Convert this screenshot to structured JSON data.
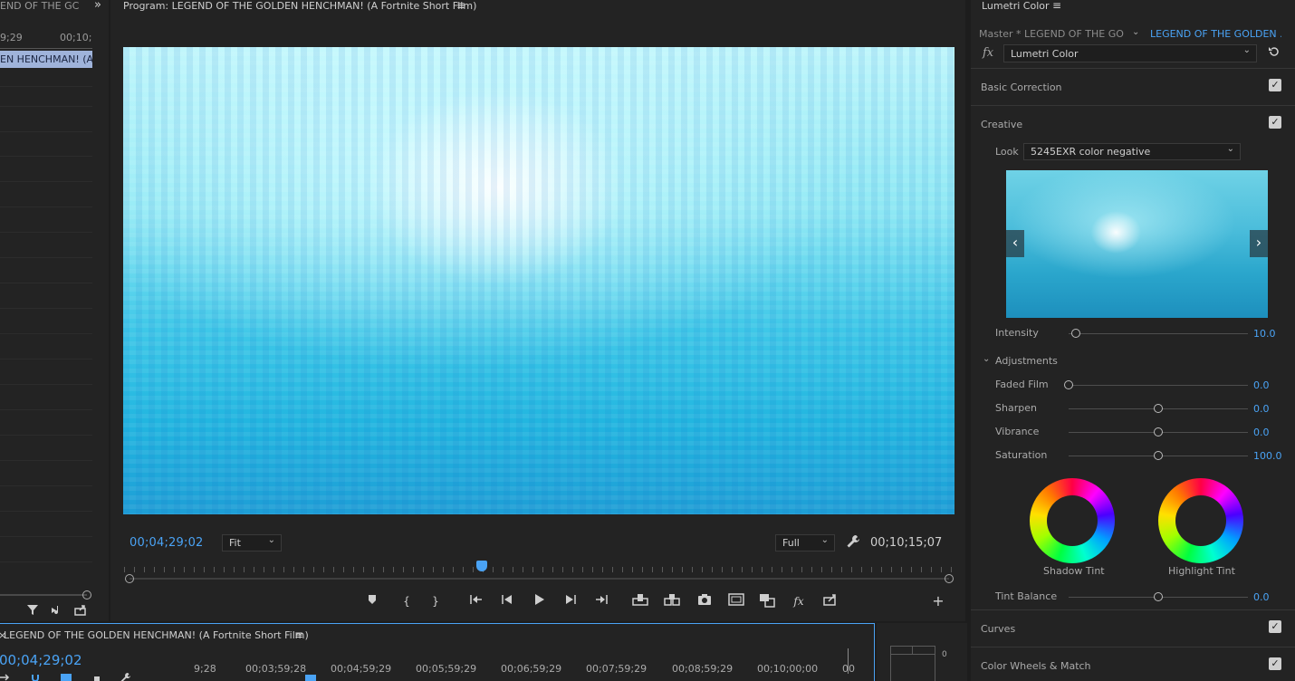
{
  "left_panel": {
    "tab_title": "END OF THE GC",
    "more_icon": "»",
    "ruler": [
      "9;29",
      "00;10;("
    ],
    "clip_label": "EN HENCHMAN! (A"
  },
  "program_monitor": {
    "title": "Program: LEGEND OF THE GOLDEN HENCHMAN! (A Fortnite Short Film)",
    "menu_icon": "≡",
    "current_timecode": "00;04;29;02",
    "zoom_select": "Fit",
    "resolution_select": "Full",
    "duration_timecode": "00;10;15;07",
    "playhead_fraction": 0.43,
    "transport": {
      "marker": "marker-icon",
      "in_point": "mark-in-icon",
      "out_point": "mark-out-icon",
      "go_to_in": "go-to-in-icon",
      "step_back": "step-back-icon",
      "play": "play-icon",
      "step_forward": "step-forward-icon",
      "go_to_out": "go-to-out-icon",
      "lift": "lift-icon",
      "extract": "extract-icon",
      "export_frame": "camera-icon",
      "safe_margins": "safe-margins-icon",
      "comparison": "comparison-view-icon",
      "fx": "fx",
      "export": "export-icon",
      "add": "+"
    }
  },
  "lumetri": {
    "title": "Lumetri Color",
    "menu_icon": "≡",
    "master_label": "Master * LEGEND OF THE GO...",
    "clip_label": "LEGEND OF THE GOLDEN ...",
    "fx_label": "fx",
    "effect_select": "Lumetri Color",
    "sections": {
      "basic_correction": "Basic Correction",
      "creative": "Creative",
      "curves": "Curves",
      "color_wheels": "Color Wheels & Match"
    },
    "checkmark": "✓",
    "look_label": "Look",
    "look_value": "5245EXR color negative",
    "intensity": {
      "label": "Intensity",
      "value": "10.0",
      "fraction": 0.04
    },
    "adjustments_label": "Adjustments",
    "sliders": [
      {
        "label": "Faded Film",
        "value": "0.0",
        "fraction": 0.0
      },
      {
        "label": "Sharpen",
        "value": "0.0",
        "fraction": 0.5
      },
      {
        "label": "Vibrance",
        "value": "0.0",
        "fraction": 0.5
      },
      {
        "label": "Saturation",
        "value": "100.0",
        "fraction": 0.5
      }
    ],
    "shadow_tint": "Shadow Tint",
    "highlight_tint": "Highlight Tint",
    "tint_balance": {
      "label": "Tint Balance",
      "value": "0.0",
      "fraction": 0.5
    }
  },
  "timeline": {
    "close_icon": "×",
    "title": "LEGEND OF THE GOLDEN HENCHMAN! (A Fortnite Short Film)",
    "menu_icon": "≡",
    "timecode": "00;04;29;02",
    "ticks": [
      "9;28",
      "00;03;59;28",
      "00;04;59;29",
      "00;05;59;29",
      "00;06;59;29",
      "00;07;59;29",
      "00;08;59;29",
      "00;10;00;00",
      "00"
    ]
  },
  "audio_meter": {
    "zero_label": "0"
  },
  "colors": {
    "accent": "#4aa3f5",
    "panel": "#232323",
    "background": "#1d1d1d"
  }
}
